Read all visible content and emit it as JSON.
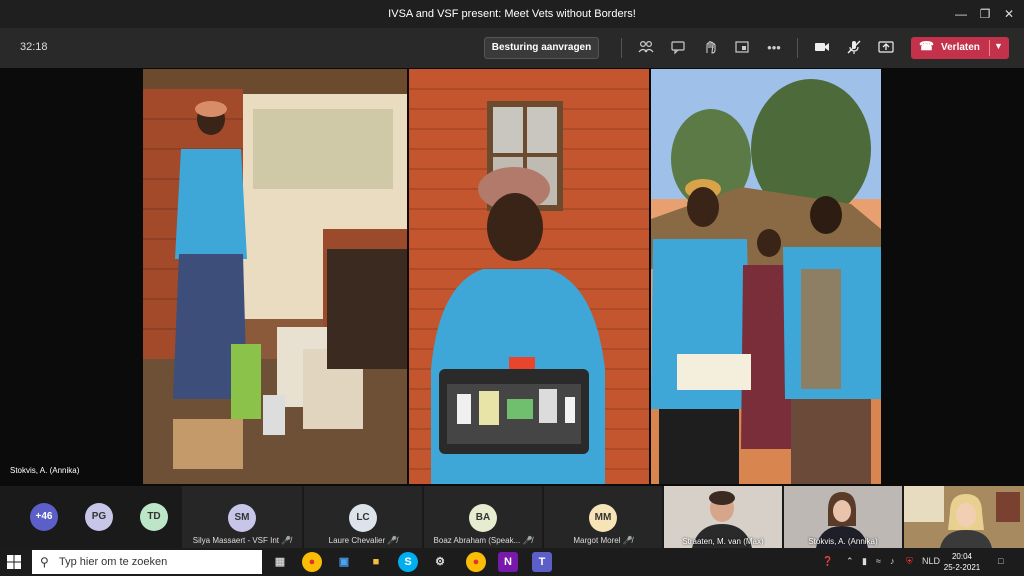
{
  "window": {
    "title": "IVSA and VSF present: Meet Vets without Borders!"
  },
  "toolbar": {
    "timer": "32:18",
    "request_control": "Besturing aanvragen",
    "leave_label": "Verlaten",
    "icons": [
      "participants-icon",
      "chat-icon",
      "reactions-icon",
      "rooms-icon",
      "more-icon",
      "camera-icon",
      "mic-off-icon",
      "share-icon"
    ],
    "leave_color": "#c4314b"
  },
  "stage": {
    "presenter": "Stokvis, A. (Annika)"
  },
  "participants": {
    "overflow": "+46",
    "initials": [
      {
        "initials": "PG",
        "color": "#c8c6e8"
      },
      {
        "initials": "TD",
        "color": "#bde5c8"
      }
    ],
    "tiles": [
      {
        "initials": "SM",
        "name": "Silya Massaert - VSF Int",
        "color": "#c8c6e8"
      },
      {
        "initials": "LC",
        "name": "Laure Chevalier",
        "color": "#dde3ea"
      },
      {
        "initials": "BA",
        "name": "Boaz Abraham (Speak...",
        "color": "#e6eccf"
      },
      {
        "initials": "MM",
        "name": "Margot Morel",
        "color": "#f6e3b6"
      }
    ],
    "videos": [
      {
        "name": "Straaten, M. van (Max)"
      },
      {
        "name": "Stokvis, A. (Annika)"
      },
      {
        "name": ""
      }
    ]
  },
  "taskbar": {
    "search_placeholder": "Typ hier om te zoeken",
    "language": "NLD",
    "time": "20:04",
    "date": "25-2-2021"
  }
}
